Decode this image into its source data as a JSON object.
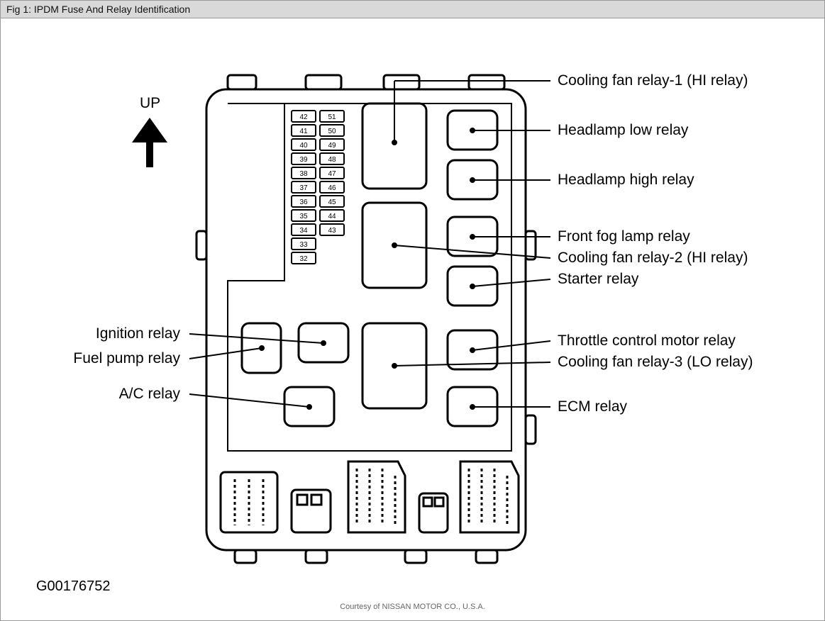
{
  "title": "Fig 1: IPDM Fuse And Relay Identification",
  "credit": "Courtesy of NISSAN MOTOR CO., U.S.A.",
  "doc_id": "G00176752",
  "up_label": "UP",
  "labels": {
    "cooling_fan_1": "Cooling fan relay-1 (HI relay)",
    "headlamp_low": "Headlamp low relay",
    "headlamp_high": "Headlamp high relay",
    "front_fog": "Front fog lamp relay",
    "cooling_fan_2": "Cooling fan relay-2 (HI relay)",
    "starter": "Starter relay",
    "throttle": "Throttle control motor relay",
    "cooling_fan_3": "Cooling fan relay-3 (LO relay)",
    "ecm": "ECM relay",
    "ignition": "Ignition relay",
    "fuel_pump": "Fuel pump relay",
    "ac": "A/C relay"
  },
  "fuses": {
    "col1": [
      "42",
      "41",
      "40",
      "39",
      "38",
      "37",
      "36",
      "35",
      "34",
      "33",
      "32"
    ],
    "col2": [
      "51",
      "50",
      "49",
      "48",
      "47",
      "46",
      "45",
      "44",
      "43"
    ]
  }
}
